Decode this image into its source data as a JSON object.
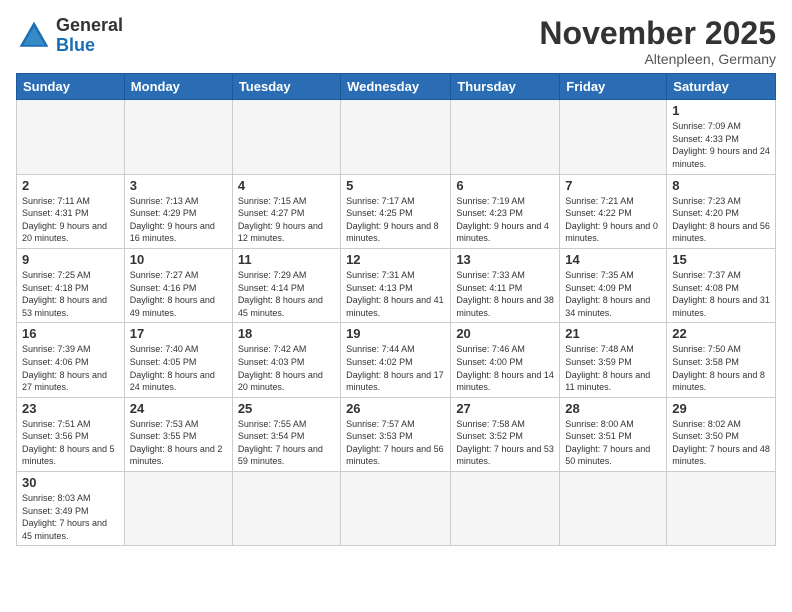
{
  "logo": {
    "text_general": "General",
    "text_blue": "Blue"
  },
  "header": {
    "month": "November 2025",
    "location": "Altenpleen, Germany"
  },
  "weekdays": [
    "Sunday",
    "Monday",
    "Tuesday",
    "Wednesday",
    "Thursday",
    "Friday",
    "Saturday"
  ],
  "weeks": [
    [
      {
        "day": "",
        "info": ""
      },
      {
        "day": "",
        "info": ""
      },
      {
        "day": "",
        "info": ""
      },
      {
        "day": "",
        "info": ""
      },
      {
        "day": "",
        "info": ""
      },
      {
        "day": "",
        "info": ""
      },
      {
        "day": "1",
        "info": "Sunrise: 7:09 AM\nSunset: 4:33 PM\nDaylight: 9 hours and 24 minutes."
      }
    ],
    [
      {
        "day": "2",
        "info": "Sunrise: 7:11 AM\nSunset: 4:31 PM\nDaylight: 9 hours and 20 minutes."
      },
      {
        "day": "3",
        "info": "Sunrise: 7:13 AM\nSunset: 4:29 PM\nDaylight: 9 hours and 16 minutes."
      },
      {
        "day": "4",
        "info": "Sunrise: 7:15 AM\nSunset: 4:27 PM\nDaylight: 9 hours and 12 minutes."
      },
      {
        "day": "5",
        "info": "Sunrise: 7:17 AM\nSunset: 4:25 PM\nDaylight: 9 hours and 8 minutes."
      },
      {
        "day": "6",
        "info": "Sunrise: 7:19 AM\nSunset: 4:23 PM\nDaylight: 9 hours and 4 minutes."
      },
      {
        "day": "7",
        "info": "Sunrise: 7:21 AM\nSunset: 4:22 PM\nDaylight: 9 hours and 0 minutes."
      },
      {
        "day": "8",
        "info": "Sunrise: 7:23 AM\nSunset: 4:20 PM\nDaylight: 8 hours and 56 minutes."
      }
    ],
    [
      {
        "day": "9",
        "info": "Sunrise: 7:25 AM\nSunset: 4:18 PM\nDaylight: 8 hours and 53 minutes."
      },
      {
        "day": "10",
        "info": "Sunrise: 7:27 AM\nSunset: 4:16 PM\nDaylight: 8 hours and 49 minutes."
      },
      {
        "day": "11",
        "info": "Sunrise: 7:29 AM\nSunset: 4:14 PM\nDaylight: 8 hours and 45 minutes."
      },
      {
        "day": "12",
        "info": "Sunrise: 7:31 AM\nSunset: 4:13 PM\nDaylight: 8 hours and 41 minutes."
      },
      {
        "day": "13",
        "info": "Sunrise: 7:33 AM\nSunset: 4:11 PM\nDaylight: 8 hours and 38 minutes."
      },
      {
        "day": "14",
        "info": "Sunrise: 7:35 AM\nSunset: 4:09 PM\nDaylight: 8 hours and 34 minutes."
      },
      {
        "day": "15",
        "info": "Sunrise: 7:37 AM\nSunset: 4:08 PM\nDaylight: 8 hours and 31 minutes."
      }
    ],
    [
      {
        "day": "16",
        "info": "Sunrise: 7:39 AM\nSunset: 4:06 PM\nDaylight: 8 hours and 27 minutes."
      },
      {
        "day": "17",
        "info": "Sunrise: 7:40 AM\nSunset: 4:05 PM\nDaylight: 8 hours and 24 minutes."
      },
      {
        "day": "18",
        "info": "Sunrise: 7:42 AM\nSunset: 4:03 PM\nDaylight: 8 hours and 20 minutes."
      },
      {
        "day": "19",
        "info": "Sunrise: 7:44 AM\nSunset: 4:02 PM\nDaylight: 8 hours and 17 minutes."
      },
      {
        "day": "20",
        "info": "Sunrise: 7:46 AM\nSunset: 4:00 PM\nDaylight: 8 hours and 14 minutes."
      },
      {
        "day": "21",
        "info": "Sunrise: 7:48 AM\nSunset: 3:59 PM\nDaylight: 8 hours and 11 minutes."
      },
      {
        "day": "22",
        "info": "Sunrise: 7:50 AM\nSunset: 3:58 PM\nDaylight: 8 hours and 8 minutes."
      }
    ],
    [
      {
        "day": "23",
        "info": "Sunrise: 7:51 AM\nSunset: 3:56 PM\nDaylight: 8 hours and 5 minutes."
      },
      {
        "day": "24",
        "info": "Sunrise: 7:53 AM\nSunset: 3:55 PM\nDaylight: 8 hours and 2 minutes."
      },
      {
        "day": "25",
        "info": "Sunrise: 7:55 AM\nSunset: 3:54 PM\nDaylight: 7 hours and 59 minutes."
      },
      {
        "day": "26",
        "info": "Sunrise: 7:57 AM\nSunset: 3:53 PM\nDaylight: 7 hours and 56 minutes."
      },
      {
        "day": "27",
        "info": "Sunrise: 7:58 AM\nSunset: 3:52 PM\nDaylight: 7 hours and 53 minutes."
      },
      {
        "day": "28",
        "info": "Sunrise: 8:00 AM\nSunset: 3:51 PM\nDaylight: 7 hours and 50 minutes."
      },
      {
        "day": "29",
        "info": "Sunrise: 8:02 AM\nSunset: 3:50 PM\nDaylight: 7 hours and 48 minutes."
      }
    ],
    [
      {
        "day": "30",
        "info": "Sunrise: 8:03 AM\nSunset: 3:49 PM\nDaylight: 7 hours and 45 minutes."
      },
      {
        "day": "",
        "info": ""
      },
      {
        "day": "",
        "info": ""
      },
      {
        "day": "",
        "info": ""
      },
      {
        "day": "",
        "info": ""
      },
      {
        "day": "",
        "info": ""
      },
      {
        "day": "",
        "info": ""
      }
    ]
  ]
}
